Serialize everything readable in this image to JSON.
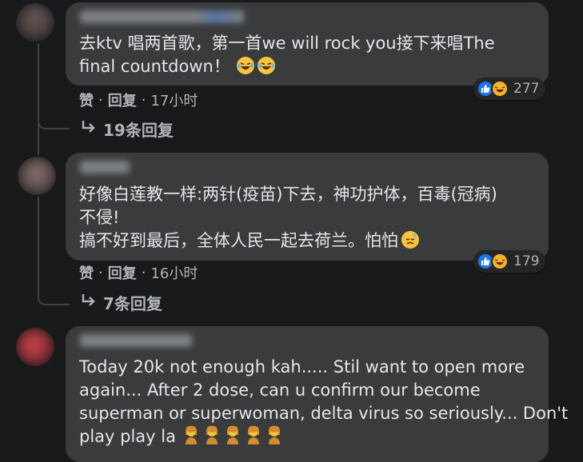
{
  "comments": [
    {
      "text_lines": [
        "去ktv 唱两首歌，第一首we will rock you接下来唱The",
        "final countdown！"
      ],
      "text_emojis": [
        "laughing-crying",
        "laughing-crying"
      ],
      "reaction_count": "277",
      "like_label": "赞",
      "reply_label": "回复",
      "time": "17小时",
      "replies_label": "19条回复"
    },
    {
      "text_lines": [
        "好像白莲教一样:两针(疫苗)下去，神功护体，百毒(冠病)",
        "不侵!",
        "搞不好到最后，全体人民一起去荷兰。怕怕"
      ],
      "text_emojis": [
        "sweat-face"
      ],
      "reaction_count": "179",
      "like_label": "赞",
      "reply_label": "回复",
      "time": "16小时",
      "replies_label": "7条回复"
    },
    {
      "text_lines": [
        "Today 20k not enough kah..... Stil want to open more",
        "again... After 2 dose, can u confirm our become",
        "superman or superwoman, delta virus so seriously... Don't",
        "play play la"
      ],
      "text_emojis": [
        "facepalm-woman",
        "facepalm-woman",
        "facepalm-woman",
        "facepalm-woman",
        "facepalm-woman"
      ]
    }
  ],
  "colors": {
    "background": "#18191a",
    "bubble": "#3a3b3c",
    "text": "#e4e6eb",
    "secondary_text": "#b0b3b8",
    "like_blue": "#1877f2",
    "haha_yellow": "#f7b125"
  },
  "icons": [
    "like-icon",
    "haha-icon",
    "reply-arrow-icon"
  ]
}
